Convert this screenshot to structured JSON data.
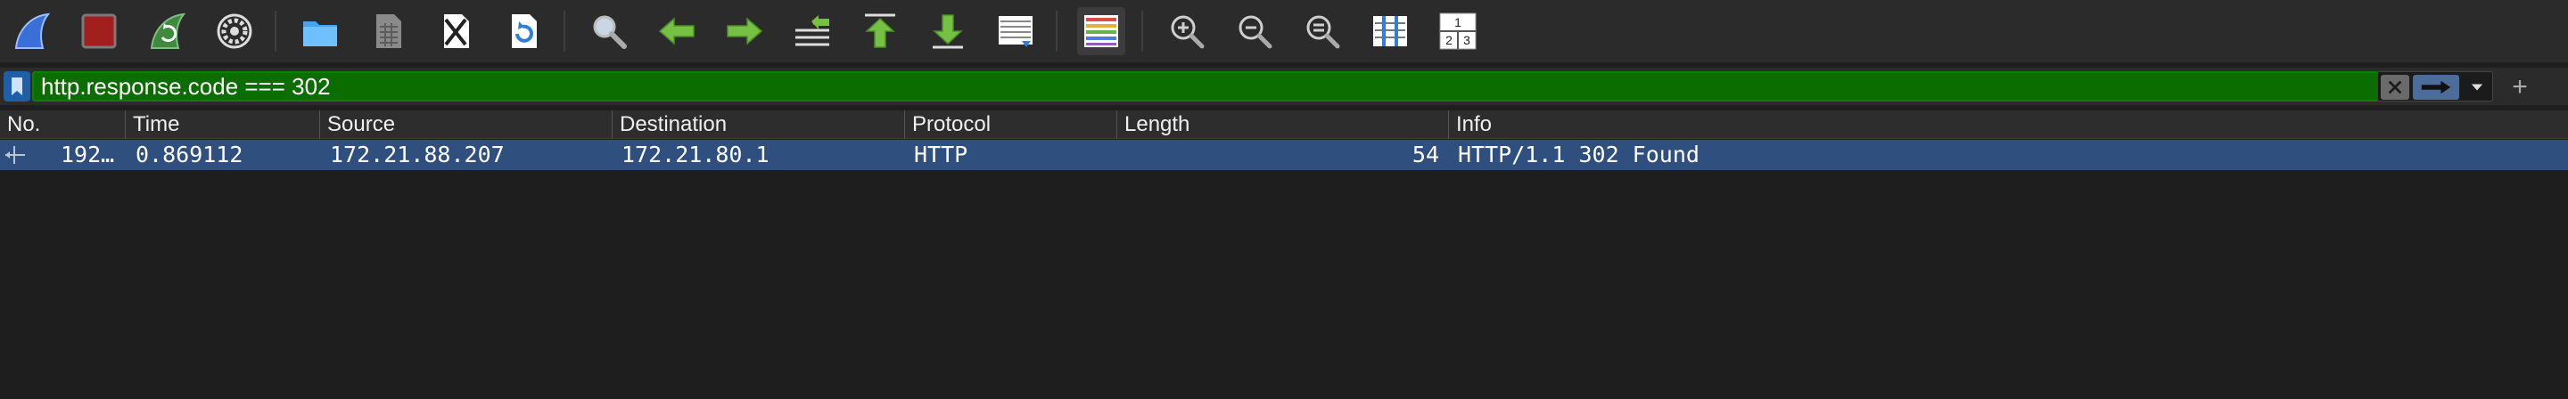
{
  "toolbar": {
    "items": [
      {
        "icon": "shark-fin-start-icon"
      },
      {
        "icon": "stop-capture-icon"
      },
      {
        "icon": "restart-capture-icon"
      },
      {
        "icon": "capture-options-gear-icon"
      },
      {
        "icon": "open-file-folder-icon"
      },
      {
        "icon": "save-file-icon"
      },
      {
        "icon": "close-file-icon"
      },
      {
        "icon": "reload-file-icon"
      },
      {
        "icon": "find-packet-magnifier-icon"
      },
      {
        "icon": "go-back-arrow-icon"
      },
      {
        "icon": "go-forward-arrow-icon"
      },
      {
        "icon": "go-to-packet-icon"
      },
      {
        "icon": "go-to-first-packet-icon"
      },
      {
        "icon": "go-to-last-packet-icon"
      },
      {
        "icon": "auto-scroll-icon"
      },
      {
        "icon": "colorize-icon"
      },
      {
        "icon": "zoom-in-icon"
      },
      {
        "icon": "zoom-out-icon"
      },
      {
        "icon": "normal-size-icon"
      },
      {
        "icon": "resize-columns-icon"
      },
      {
        "icon": "layout-panes-icon"
      }
    ],
    "layout_digits": [
      "1",
      "2",
      "3"
    ]
  },
  "filter": {
    "value": "http.response.code === 302",
    "valid_color": "#0b6d00",
    "add_label": "+"
  },
  "packet_list": {
    "columns": [
      "No.",
      "Time",
      "Source",
      "Destination",
      "Protocol",
      "Length",
      "Info"
    ],
    "rows": [
      {
        "no": "192…",
        "time": "0.869112",
        "source": "172.21.88.207",
        "destination": "172.21.80.1",
        "protocol": "HTTP",
        "length": "54",
        "info": "HTTP/1.1 302 Found"
      }
    ],
    "selected_row_color": "#2f4f7e"
  }
}
